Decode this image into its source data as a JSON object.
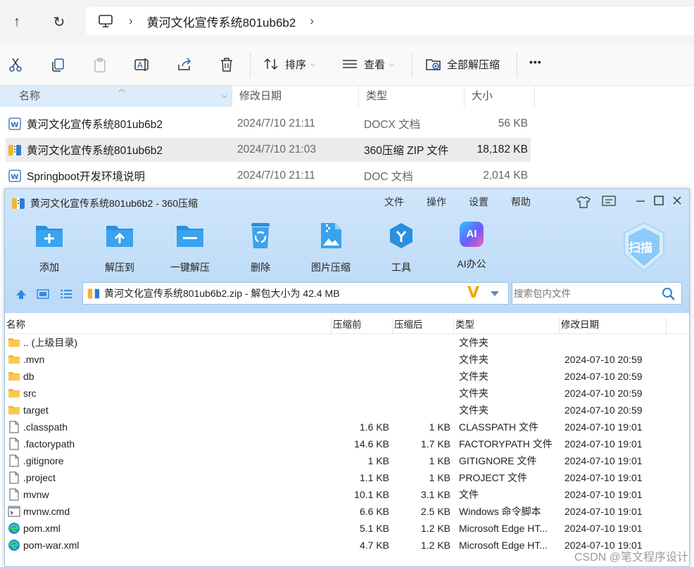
{
  "explorer": {
    "nav": {
      "up": "↑",
      "refresh": "↻"
    },
    "address": {
      "crumb": "黄河文化宣传系统801ub6b2",
      "sep": "›",
      "sep2": "›"
    },
    "cmdbar": {
      "sort_label": "排序",
      "view_label": "查看",
      "extract_label": "全部解压缩",
      "more": "•••"
    },
    "columns": {
      "name": "名称",
      "date": "修改日期",
      "type": "类型",
      "size": "大小"
    },
    "files": [
      {
        "name": "黄河文化宣传系统801ub6b2",
        "date": "2024/7/10 21:11",
        "type": "DOCX 文档",
        "size": "56 KB",
        "icon": "word-icon"
      },
      {
        "name": "黄河文化宣传系统801ub6b2",
        "date": "2024/7/10 21:03",
        "type": "360压缩 ZIP 文件",
        "size": "18,182 KB",
        "icon": "zip-icon"
      },
      {
        "name": "Springboot开发环境说明",
        "date": "2024/7/10 21:11",
        "type": "DOC 文档",
        "size": "2,014 KB",
        "icon": "word-icon"
      }
    ]
  },
  "zipwin": {
    "title": "黄河文化宣传系统801ub6b2 - 360压缩",
    "menu": [
      "文件",
      "操作",
      "设置",
      "帮助"
    ],
    "tools": [
      "添加",
      "解压到",
      "一键解压",
      "删除",
      "图片压缩",
      "工具",
      "AI办公"
    ],
    "scan_label": "扫描",
    "ai_badge": "AI",
    "path_text": "黄河文化宣传系统801ub6b2.zip - 解包大小为 42.4 MB",
    "search_placeholder": "搜索包内文件",
    "columns": {
      "name": "名称",
      "before": "压缩前",
      "after": "压缩后",
      "type": "类型",
      "date": "修改日期"
    },
    "rows": [
      {
        "name": ".. (上级目录)",
        "before": "",
        "after": "",
        "type": "文件夹",
        "date": "",
        "icon": "folder-icon"
      },
      {
        "name": ".mvn",
        "before": "",
        "after": "",
        "type": "文件夹",
        "date": "2024-07-10 20:59",
        "icon": "folder-icon"
      },
      {
        "name": "db",
        "before": "",
        "after": "",
        "type": "文件夹",
        "date": "2024-07-10 20:59",
        "icon": "folder-icon"
      },
      {
        "name": "src",
        "before": "",
        "after": "",
        "type": "文件夹",
        "date": "2024-07-10 20:59",
        "icon": "folder-icon"
      },
      {
        "name": "target",
        "before": "",
        "after": "",
        "type": "文件夹",
        "date": "2024-07-10 20:59",
        "icon": "folder-icon"
      },
      {
        "name": ".classpath",
        "before": "1.6 KB",
        "after": "1 KB",
        "type": "CLASSPATH 文件",
        "date": "2024-07-10 19:01",
        "icon": "file-icon"
      },
      {
        "name": ".factorypath",
        "before": "14.6 KB",
        "after": "1.7 KB",
        "type": "FACTORYPATH 文件",
        "date": "2024-07-10 19:01",
        "icon": "file-icon"
      },
      {
        "name": ".gitignore",
        "before": "1 KB",
        "after": "1 KB",
        "type": "GITIGNORE 文件",
        "date": "2024-07-10 19:01",
        "icon": "file-icon"
      },
      {
        "name": ".project",
        "before": "1.1 KB",
        "after": "1 KB",
        "type": "PROJECT 文件",
        "date": "2024-07-10 19:01",
        "icon": "file-icon"
      },
      {
        "name": "mvnw",
        "before": "10.1 KB",
        "after": "3.1 KB",
        "type": "文件",
        "date": "2024-07-10 19:01",
        "icon": "file-icon"
      },
      {
        "name": "mvnw.cmd",
        "before": "6.6 KB",
        "after": "2.5 KB",
        "type": "Windows 命令脚本",
        "date": "2024-07-10 19:01",
        "icon": "cmd-icon"
      },
      {
        "name": "pom.xml",
        "before": "5.1 KB",
        "after": "1.2 KB",
        "type": "Microsoft Edge HT...",
        "date": "2024-07-10 19:01",
        "icon": "edge-icon"
      },
      {
        "name": "pom-war.xml",
        "before": "4.7 KB",
        "after": "1.2 KB",
        "type": "Microsoft Edge HT...",
        "date": "2024-07-10 19:01",
        "icon": "edge-icon"
      }
    ]
  },
  "watermark": "CSDN @笔文程序设计"
}
